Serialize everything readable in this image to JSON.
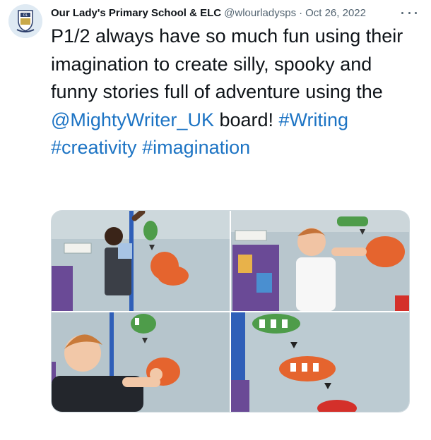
{
  "tweet": {
    "author_name": "Our Lady's Primary School & ELC",
    "handle": "@wlourladysps",
    "separator": "·",
    "date": "Oct 26, 2022",
    "text_plain": "P1/2 always have so much fun using their imagination to create silly, spooky and funny stories full of adventure using the ",
    "mention": "@MightyWriter_UK",
    "text_after_mention": " board! ",
    "hashtags": [
      "#Writing",
      "#creativity",
      "#imagination"
    ]
  },
  "colors": {
    "link": "#1d74c4",
    "secondary_text": "#536471",
    "primary_text": "#0f1419",
    "border": "#cfd9de"
  },
  "icons": {
    "avatar": "school-crest-avatar",
    "more": "more-options-icon"
  },
  "media": {
    "photo_count": 4
  }
}
